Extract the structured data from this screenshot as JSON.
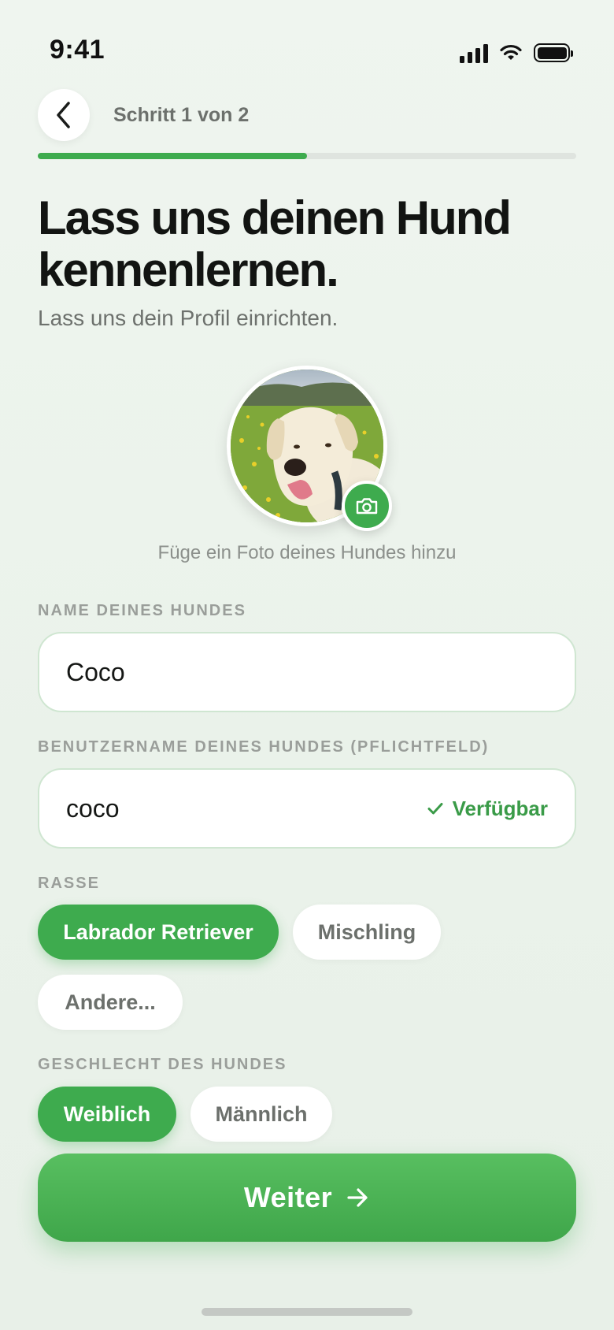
{
  "status_bar": {
    "time": "9:41"
  },
  "header": {
    "step_label": "Schritt 1 von 2",
    "progress": 0.5
  },
  "intro": {
    "title": "Lass uns deinen Hund kennenlernen.",
    "subtitle": "Lass uns dein Profil einrichten."
  },
  "photo": {
    "caption": "Füge ein Foto deines Hundes hinzu"
  },
  "dog_name": {
    "label": "NAME DEINES HUNDES",
    "value": "Coco"
  },
  "username": {
    "label": "BENUTZERNAME DEINES HUNDES (PFLICHTFELD)",
    "value": "coco",
    "status": "Verfügbar"
  },
  "breed": {
    "label": "RASSE",
    "options": [
      "Labrador Retriever",
      "Mischling",
      "Andere..."
    ],
    "selected": "Labrador Retriever"
  },
  "gender": {
    "label": "GESCHLECHT DES HUNDES",
    "options": [
      "Weiblich",
      "Männlich"
    ],
    "selected": "Weiblich"
  },
  "cta": {
    "label": "Weiter"
  },
  "colors": {
    "accent": "#3eab4e",
    "background": "#eef4ee"
  }
}
